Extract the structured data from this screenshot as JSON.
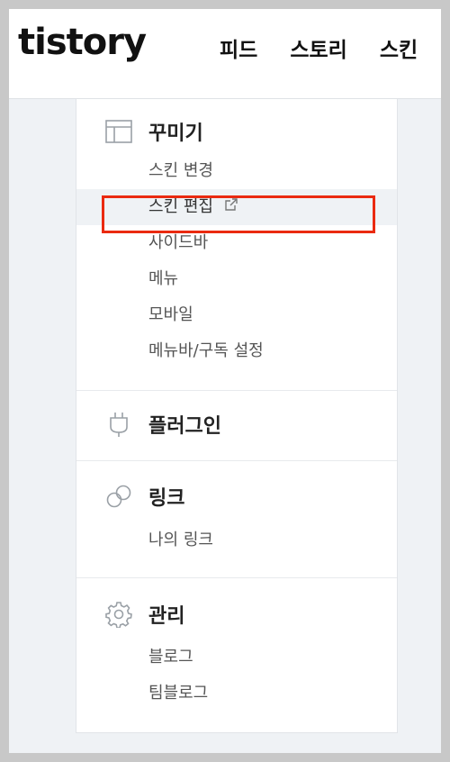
{
  "header": {
    "logo": "tistory",
    "nav": [
      "피드",
      "스토리",
      "스킨"
    ]
  },
  "sections": {
    "decorate": {
      "title": "꾸미기",
      "icon": "layout-icon",
      "items": [
        "스킨 변경",
        "스킨 편집",
        "사이드바",
        "메뉴",
        "모바일",
        "메뉴바/구독 설정"
      ]
    },
    "plugin": {
      "title": "플러그인",
      "icon": "plug-icon"
    },
    "link": {
      "title": "링크",
      "icon": "link-icon",
      "items": [
        "나의 링크"
      ]
    },
    "manage": {
      "title": "관리",
      "icon": "gear-icon",
      "items": [
        "블로그",
        "팀블로그"
      ]
    }
  },
  "colors": {
    "highlight": "#ea2a10",
    "active_bg": "#eff2f5"
  }
}
